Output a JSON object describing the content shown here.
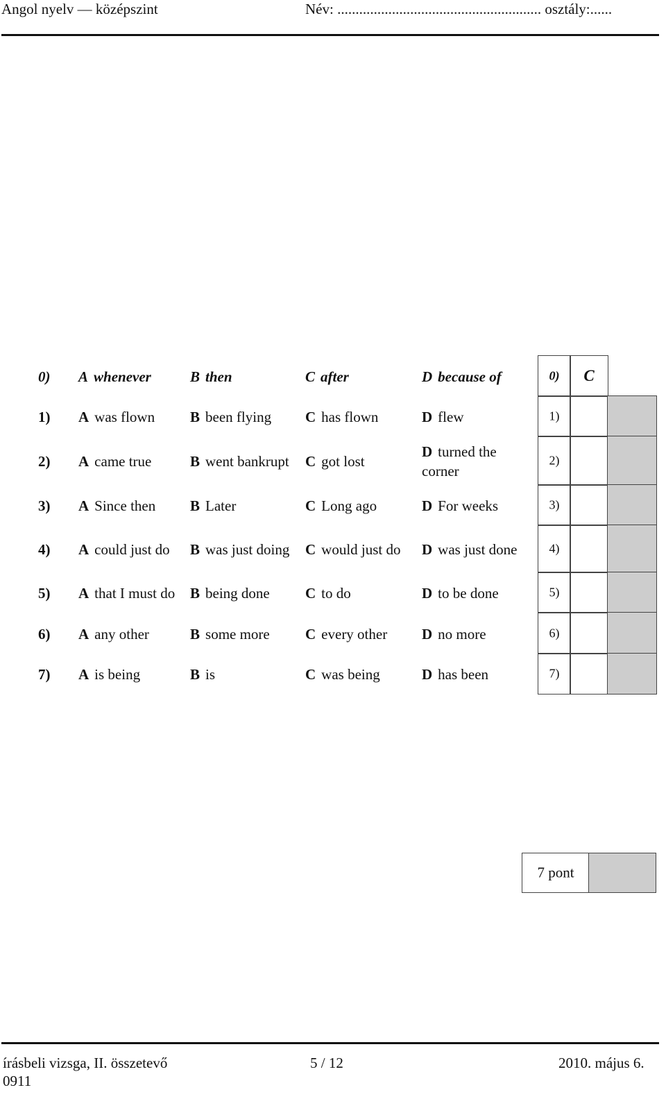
{
  "header": {
    "subject": "Angol nyelv — középszint",
    "name_field": "Név: ........................................................ osztály:......"
  },
  "questions": [
    {
      "number": "0)",
      "example": true,
      "options": [
        {
          "letter": "A",
          "text": "whenever"
        },
        {
          "letter": "B",
          "text": "then"
        },
        {
          "letter": "C",
          "text": "after"
        },
        {
          "letter": "D",
          "text": "because of"
        }
      ]
    },
    {
      "number": "1)",
      "options": [
        {
          "letter": "A",
          "text": "was flown"
        },
        {
          "letter": "B",
          "text": "been flying"
        },
        {
          "letter": "C",
          "text": "has flown"
        },
        {
          "letter": "D",
          "text": "flew"
        }
      ]
    },
    {
      "number": "2)",
      "options": [
        {
          "letter": "A",
          "text": "came true"
        },
        {
          "letter": "B",
          "text": "went bankrupt"
        },
        {
          "letter": "C",
          "text": "got lost"
        },
        {
          "letter": "D",
          "text": "turned the corner"
        }
      ]
    },
    {
      "number": "3)",
      "options": [
        {
          "letter": "A",
          "text": "Since then"
        },
        {
          "letter": "B",
          "text": "Later"
        },
        {
          "letter": "C",
          "text": "Long ago"
        },
        {
          "letter": "D",
          "text": "For weeks"
        }
      ]
    },
    {
      "number": "4)",
      "options": [
        {
          "letter": "A",
          "text": "could just do"
        },
        {
          "letter": "B",
          "text": "was just doing"
        },
        {
          "letter": "C",
          "text": "would just do"
        },
        {
          "letter": "D",
          "text": "was just done"
        }
      ]
    },
    {
      "number": "5)",
      "options": [
        {
          "letter": "A",
          "text": "that I must do"
        },
        {
          "letter": "B",
          "text": "being done"
        },
        {
          "letter": "C",
          "text": "to do"
        },
        {
          "letter": "D",
          "text": "to be done"
        }
      ]
    },
    {
      "number": "6)",
      "options": [
        {
          "letter": "A",
          "text": "any other"
        },
        {
          "letter": "B",
          "text": "some more"
        },
        {
          "letter": "C",
          "text": "every other"
        },
        {
          "letter": "D",
          "text": "no more"
        }
      ]
    },
    {
      "number": "7)",
      "options": [
        {
          "letter": "A",
          "text": "is being"
        },
        {
          "letter": "B",
          "text": "is"
        },
        {
          "letter": "C",
          "text": "was being"
        },
        {
          "letter": "D",
          "text": "has been"
        }
      ]
    }
  ],
  "answer_grid": [
    {
      "label": "0)",
      "answer": "C"
    },
    {
      "label": "1)",
      "answer": ""
    },
    {
      "label": "2)",
      "answer": ""
    },
    {
      "label": "3)",
      "answer": ""
    },
    {
      "label": "4)",
      "answer": ""
    },
    {
      "label": "5)",
      "answer": ""
    },
    {
      "label": "6)",
      "answer": ""
    },
    {
      "label": "7)",
      "answer": ""
    }
  ],
  "score": {
    "label": "7 pont",
    "value": ""
  },
  "footer": {
    "left_line1": "írásbeli vizsga, II. összetevő",
    "left_line2": "0911",
    "page": "5 / 12",
    "date": "2010. május 6."
  }
}
